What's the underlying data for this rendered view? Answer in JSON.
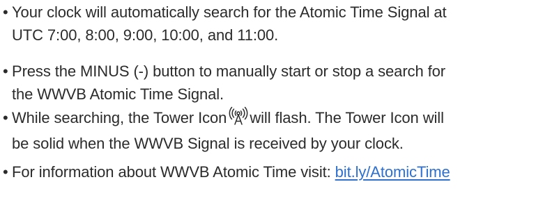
{
  "bullet_char": "•",
  "items": [
    {
      "lines": [
        "Your clock will automatically search for the Atomic Time Signal at",
        "UTC 7:00, 8:00, 9:00, 10:00, and 11:00."
      ]
    },
    {
      "lines": [
        "Press the MINUS (-) button to manually start or stop a search for",
        "the WWVB Atomic Time Signal."
      ]
    },
    {
      "before_icon": "While searching, the Tower Icon",
      "after_icon": "will flash. The Tower Icon will",
      "line2": "be solid when the WWVB Signal is received by your clock.",
      "icon": "tower-signal-icon"
    },
    {
      "text": "For information about WWVB Atomic Time visit: ",
      "link_text": "bit.ly/AtomicTime"
    }
  ],
  "colors": {
    "text": "#2b2b2b",
    "link": "#2e6fcf"
  }
}
